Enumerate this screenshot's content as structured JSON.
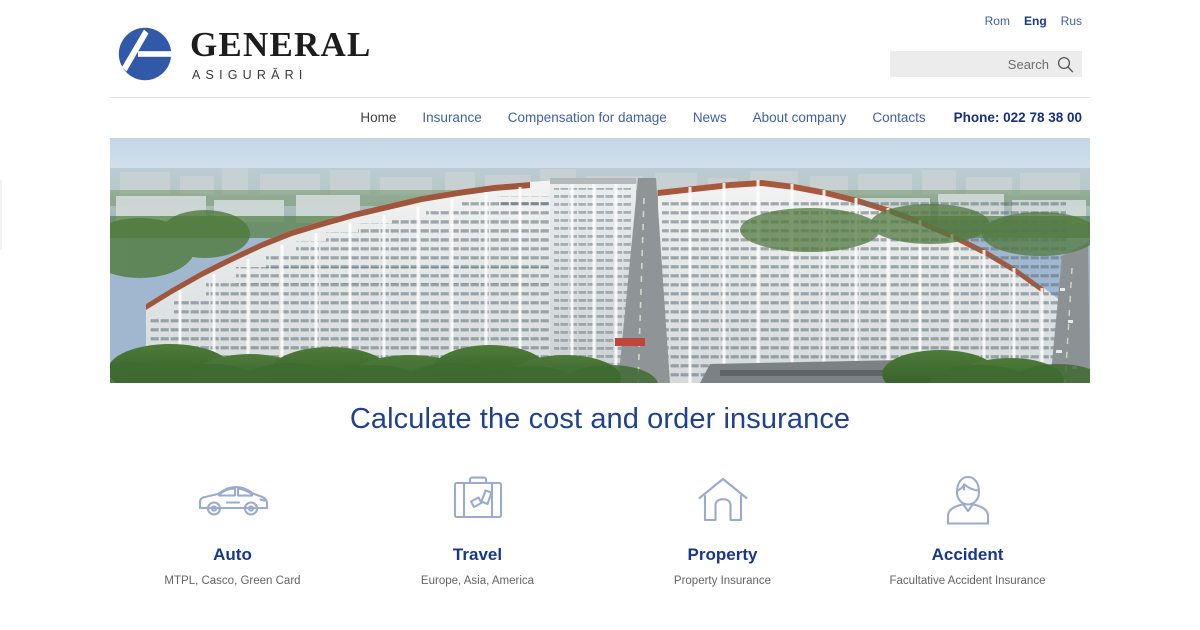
{
  "brand": {
    "name": "GENERAL",
    "tagline": "ASIGURĂRI",
    "logo_icon": "circle-slash-logo-icon",
    "logo_color": "#3258a8"
  },
  "languages": [
    {
      "code": "rom",
      "label": "Rom",
      "active": false
    },
    {
      "code": "eng",
      "label": "Eng",
      "active": true
    },
    {
      "code": "rus",
      "label": "Rus",
      "active": false
    }
  ],
  "search": {
    "placeholder": "Search",
    "value": "",
    "icon": "search-icon"
  },
  "nav": {
    "items": [
      {
        "label": "Home",
        "active": true
      },
      {
        "label": "Insurance",
        "active": false
      },
      {
        "label": "Compensation for damage",
        "active": false
      },
      {
        "label": "News",
        "active": false
      },
      {
        "label": "About company",
        "active": false
      },
      {
        "label": "Contacts",
        "active": false
      }
    ],
    "phone": "Phone: 022 78 38 00"
  },
  "hero": {
    "alt": "Aerial view of Chisinau City Gates apartment buildings"
  },
  "main": {
    "heading": "Calculate the cost and order insurance"
  },
  "services": [
    {
      "id": "auto",
      "icon": "car-icon",
      "name": "Auto",
      "desc": "MTPL, Casco, Green Card"
    },
    {
      "id": "travel",
      "icon": "suitcase-icon",
      "name": "Travel",
      "desc": "Europe, Asia, America"
    },
    {
      "id": "property",
      "icon": "house-icon",
      "name": "Property",
      "desc": "Property Insurance"
    },
    {
      "id": "accident",
      "icon": "person-icon",
      "name": "Accident",
      "desc": "Facultative Accident Insurance"
    }
  ],
  "colors": {
    "brand_blue": "#3258a8",
    "link_blue": "#3f5fa8",
    "heading_blue": "#1f4191",
    "phone_blue": "#16307e",
    "icon_blue": "#9aabcd",
    "search_bg": "#ececec"
  }
}
